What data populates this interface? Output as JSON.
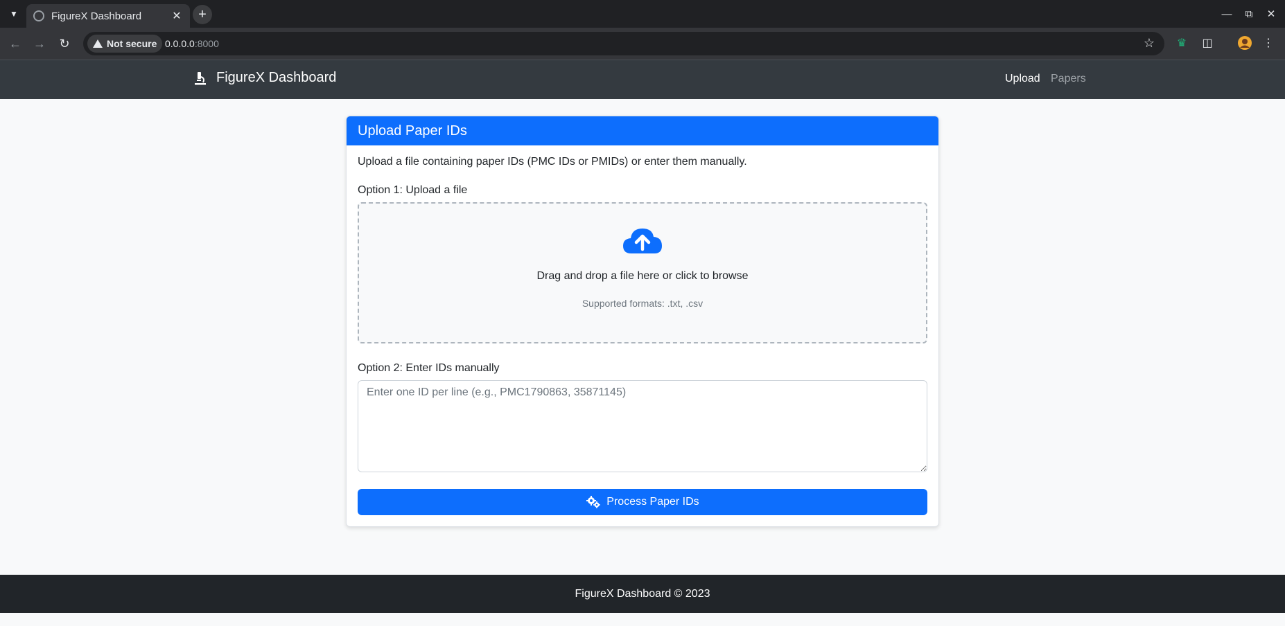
{
  "browser": {
    "tab_title": "FigureX Dashboard",
    "new_tab_label": "+",
    "security_label": "Not secure",
    "url_host": "0.0.0.0",
    "url_port": ":8000"
  },
  "navbar": {
    "brand": "FigureX Dashboard",
    "brand_icon": "microscope-icon",
    "links": [
      {
        "label": "Upload",
        "active": true
      },
      {
        "label": "Papers",
        "active": false
      }
    ]
  },
  "card": {
    "header": "Upload Paper IDs",
    "intro": "Upload a file containing paper IDs (PMC IDs or PMIDs) or enter them manually.",
    "option1_label": "Option 1: Upload a file",
    "dropzone": {
      "icon": "cloud-upload-icon",
      "text": "Drag and drop a file here or click to browse",
      "formats": "Supported formats: .txt, .csv"
    },
    "option2_label": "Option 2: Enter IDs manually",
    "textarea_placeholder": "Enter one ID per line (e.g., PMC1790863, 35871145)",
    "textarea_value": "",
    "submit_label": "Process Paper IDs",
    "submit_icon": "gears-icon"
  },
  "footer": {
    "text": "FigureX Dashboard © 2023"
  },
  "colors": {
    "primary": "#0d6efd",
    "navbar_bg": "#343a40",
    "footer_bg": "#212529",
    "page_bg": "#f8f9fa"
  }
}
